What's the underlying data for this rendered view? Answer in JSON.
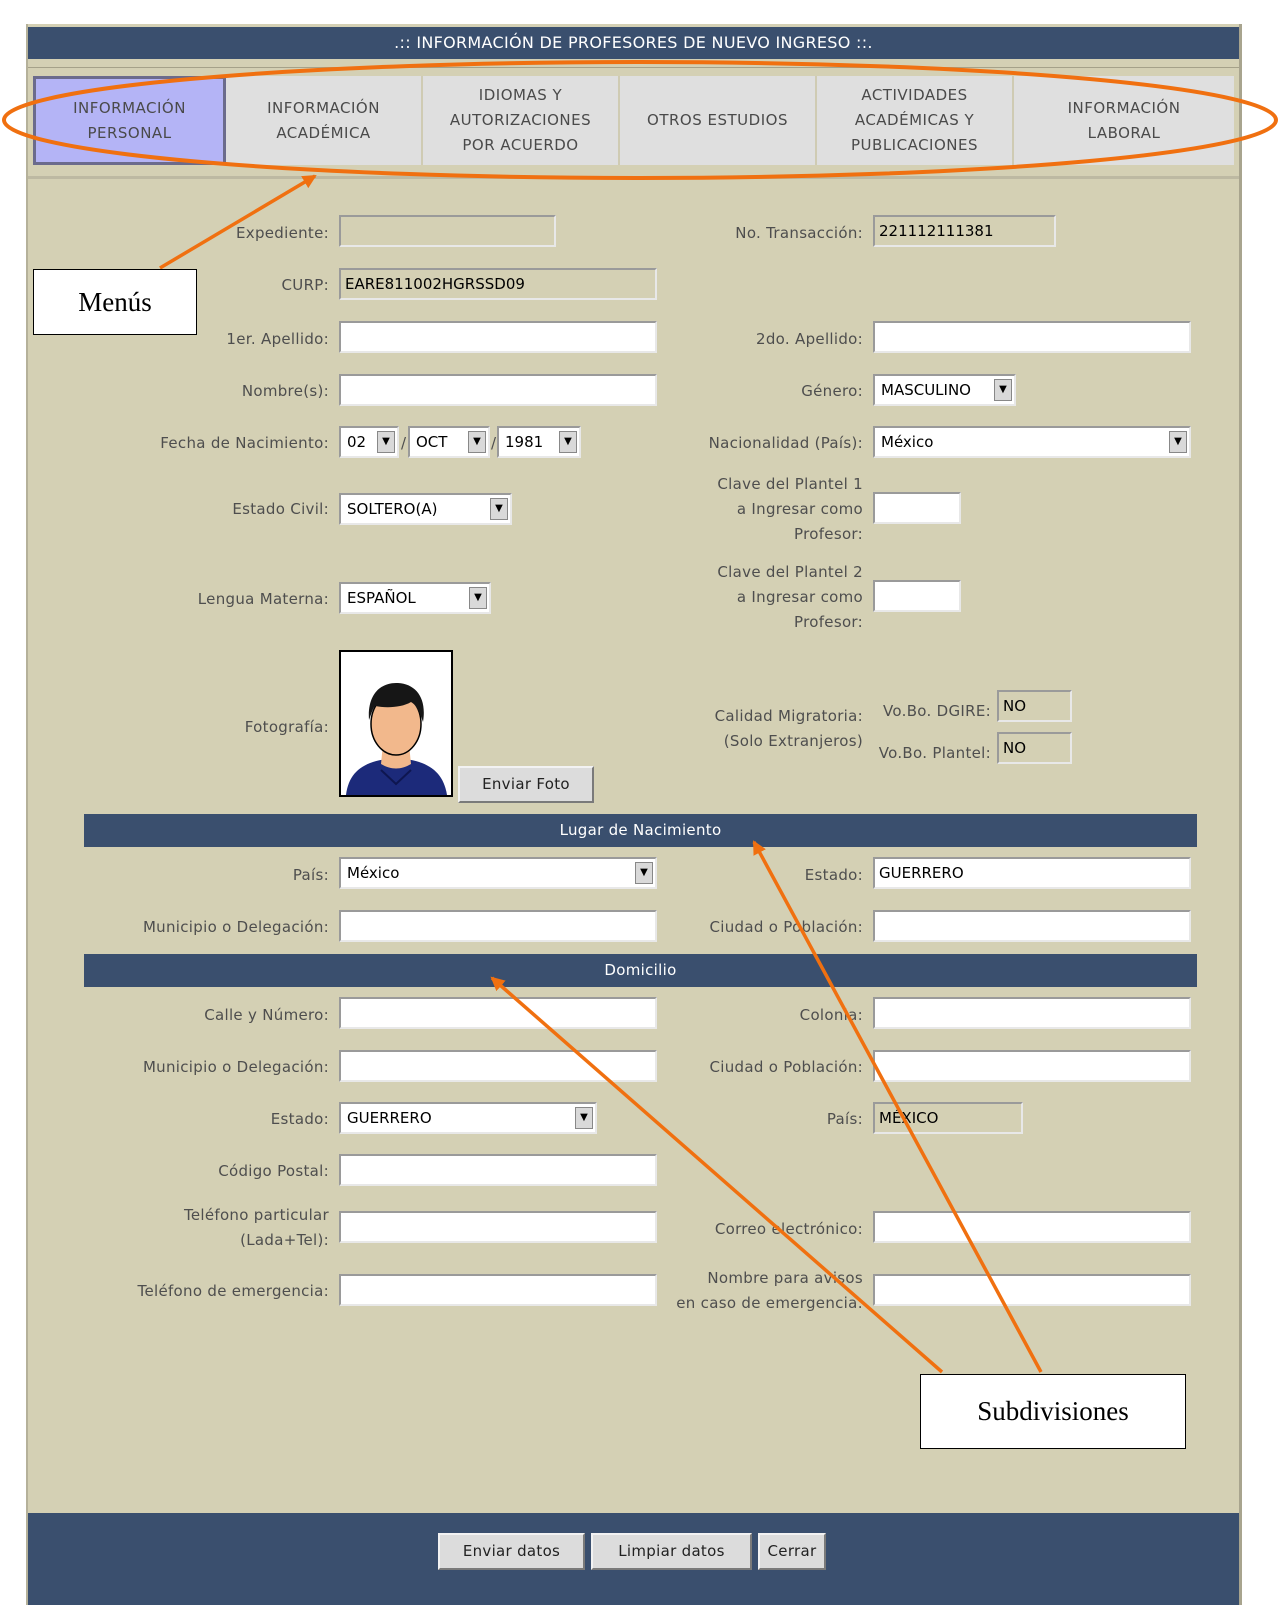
{
  "window": {
    "title": ".:: INFORMACIÓN DE PROFESORES DE NUEVO INGRESO ::."
  },
  "menu": {
    "tabs": [
      {
        "label": "INFORMACIÓN\nPERSONAL",
        "active": true
      },
      {
        "label": "INFORMACIÓN\nACADÉMICA",
        "active": false
      },
      {
        "label": "IDIOMAS Y\nAUTORIZACIONES\nPOR ACUERDO",
        "active": false
      },
      {
        "label": "OTROS ESTUDIOS",
        "active": false
      },
      {
        "label": "ACTIVIDADES\nACADÉMICAS Y\nPUBLICACIONES",
        "active": false
      },
      {
        "label": "INFORMACIÓN\nLABORAL",
        "active": false
      }
    ]
  },
  "personal": {
    "expediente": {
      "label": "Expediente:",
      "value": ""
    },
    "transaccion": {
      "label": "No. Transacción:",
      "value": "221112111381"
    },
    "curp": {
      "label": "CURP:",
      "value": "EARE811002HGRSSD09"
    },
    "apellido1": {
      "label": "1er. Apellido:",
      "value": ""
    },
    "apellido2": {
      "label": "2do. Apellido:",
      "value": ""
    },
    "nombre": {
      "label": "Nombre(s):",
      "value": ""
    },
    "genero": {
      "label": "Género:",
      "value": "MASCULINO"
    },
    "fecha": {
      "label": "Fecha de Nacimiento:",
      "day": "02",
      "month": "OCT",
      "year": "1981",
      "sep": "/"
    },
    "nacionalidad": {
      "label": "Nacionalidad (País):",
      "value": "México"
    },
    "estado_civil": {
      "label": "Estado Civil:",
      "value": "SOLTERO(A)"
    },
    "plantel1": {
      "label": "Clave del Plantel 1\na Ingresar como\nProfesor:",
      "value": ""
    },
    "lengua": {
      "label": "Lengua Materna:",
      "value": "ESPAÑOL"
    },
    "plantel2": {
      "label": "Clave del Plantel 2\na Ingresar como\nProfesor:",
      "value": ""
    },
    "fotografia": {
      "label": "Fotografía:",
      "button": "Enviar Foto"
    },
    "migratoria": {
      "label": "Calidad Migratoria:\n(Solo Extranjeros)",
      "dgire_label": "Vo.Bo. DGIRE:",
      "dgire_value": "NO",
      "plantel_label": "Vo.Bo. Plantel:",
      "plantel_value": "NO"
    }
  },
  "nacimiento": {
    "header": "Lugar de Nacimiento",
    "pais": {
      "label": "País:",
      "value": "México"
    },
    "estado": {
      "label": "Estado:",
      "value": "GUERRERO"
    },
    "municipio": {
      "label": "Municipio o Delegación:",
      "value": ""
    },
    "ciudad": {
      "label": "Ciudad o Población:",
      "value": ""
    }
  },
  "domicilio": {
    "header": "Domicilio",
    "calle": {
      "label": "Calle y Número:",
      "value": ""
    },
    "colonia": {
      "label": "Colonia:",
      "value": ""
    },
    "municipio": {
      "label": "Municipio o Delegación:",
      "value": ""
    },
    "ciudad": {
      "label": "Ciudad o Población:",
      "value": ""
    },
    "estado": {
      "label": "Estado:",
      "value": "GUERRERO"
    },
    "pais": {
      "label": "País:",
      "value": "MÉXICO"
    },
    "cp": {
      "label": "Código Postal:",
      "value": ""
    },
    "telefono": {
      "label": "Teléfono particular\n(Lada+Tel):",
      "value": ""
    },
    "correo": {
      "label": "Correo electrónico:",
      "value": ""
    },
    "emergencia_tel": {
      "label": "Teléfono de emergencia:",
      "value": ""
    },
    "emergencia_nombre": {
      "label": "Nombre para avisos\nen caso de emergencia:",
      "value": ""
    }
  },
  "footer": {
    "send": "Enviar datos",
    "clear": "Limpiar datos",
    "close": "Cerrar"
  },
  "annotations": {
    "menus": "Menús",
    "subdivisions": "Subdivisiones",
    "color": "#f07010"
  },
  "colors": {
    "header_bg": "#3a4f6e",
    "panel_bg": "#d4d0b4",
    "active_tab": "#b4b4f6"
  }
}
